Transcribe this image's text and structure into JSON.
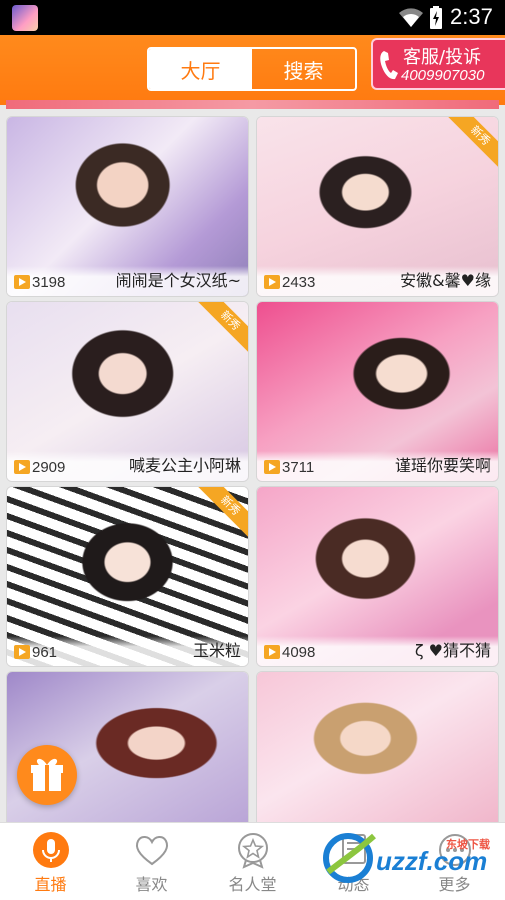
{
  "status_bar": {
    "time": "2:37"
  },
  "header": {
    "tabs": [
      {
        "label": "大厅",
        "active": true
      },
      {
        "label": "搜索",
        "active": false
      }
    ],
    "service": {
      "title": "客服/投诉",
      "phone": "4009907030"
    }
  },
  "rooms": [
    {
      "viewers": "3198",
      "title": "闹闹是个女汉纸~",
      "new": false
    },
    {
      "viewers": "2433",
      "title": "安徽&馨♥缘",
      "new": true,
      "badge": "新秀"
    },
    {
      "viewers": "2909",
      "title": "喊麦公主小阿琳",
      "new": true,
      "badge": "新秀"
    },
    {
      "viewers": "3711",
      "title": "谨瑶你要笑啊",
      "new": false
    },
    {
      "viewers": "961",
      "title": "玉米粒",
      "new": true,
      "badge": "新秀"
    },
    {
      "viewers": "4098",
      "title": "ζ  ♥猜不猜",
      "new": false
    },
    {
      "viewers": "",
      "title": "",
      "new": false
    },
    {
      "viewers": "",
      "title": "",
      "new": false
    }
  ],
  "tab_bar": [
    {
      "label": "直播",
      "icon": "mic-icon",
      "active": true
    },
    {
      "label": "喜欢",
      "icon": "heart-icon",
      "active": false
    },
    {
      "label": "名人堂",
      "icon": "star-badge-icon",
      "active": false
    },
    {
      "label": "动态",
      "icon": "feed-icon",
      "active": false
    },
    {
      "label": "更多",
      "icon": "more-icon",
      "active": false
    }
  ],
  "watermark": {
    "text": "uzzf.com",
    "sub": "东坡下载"
  },
  "colors": {
    "accent": "#ff7a10",
    "service": "#e8365b",
    "badge": "#f5a623"
  }
}
